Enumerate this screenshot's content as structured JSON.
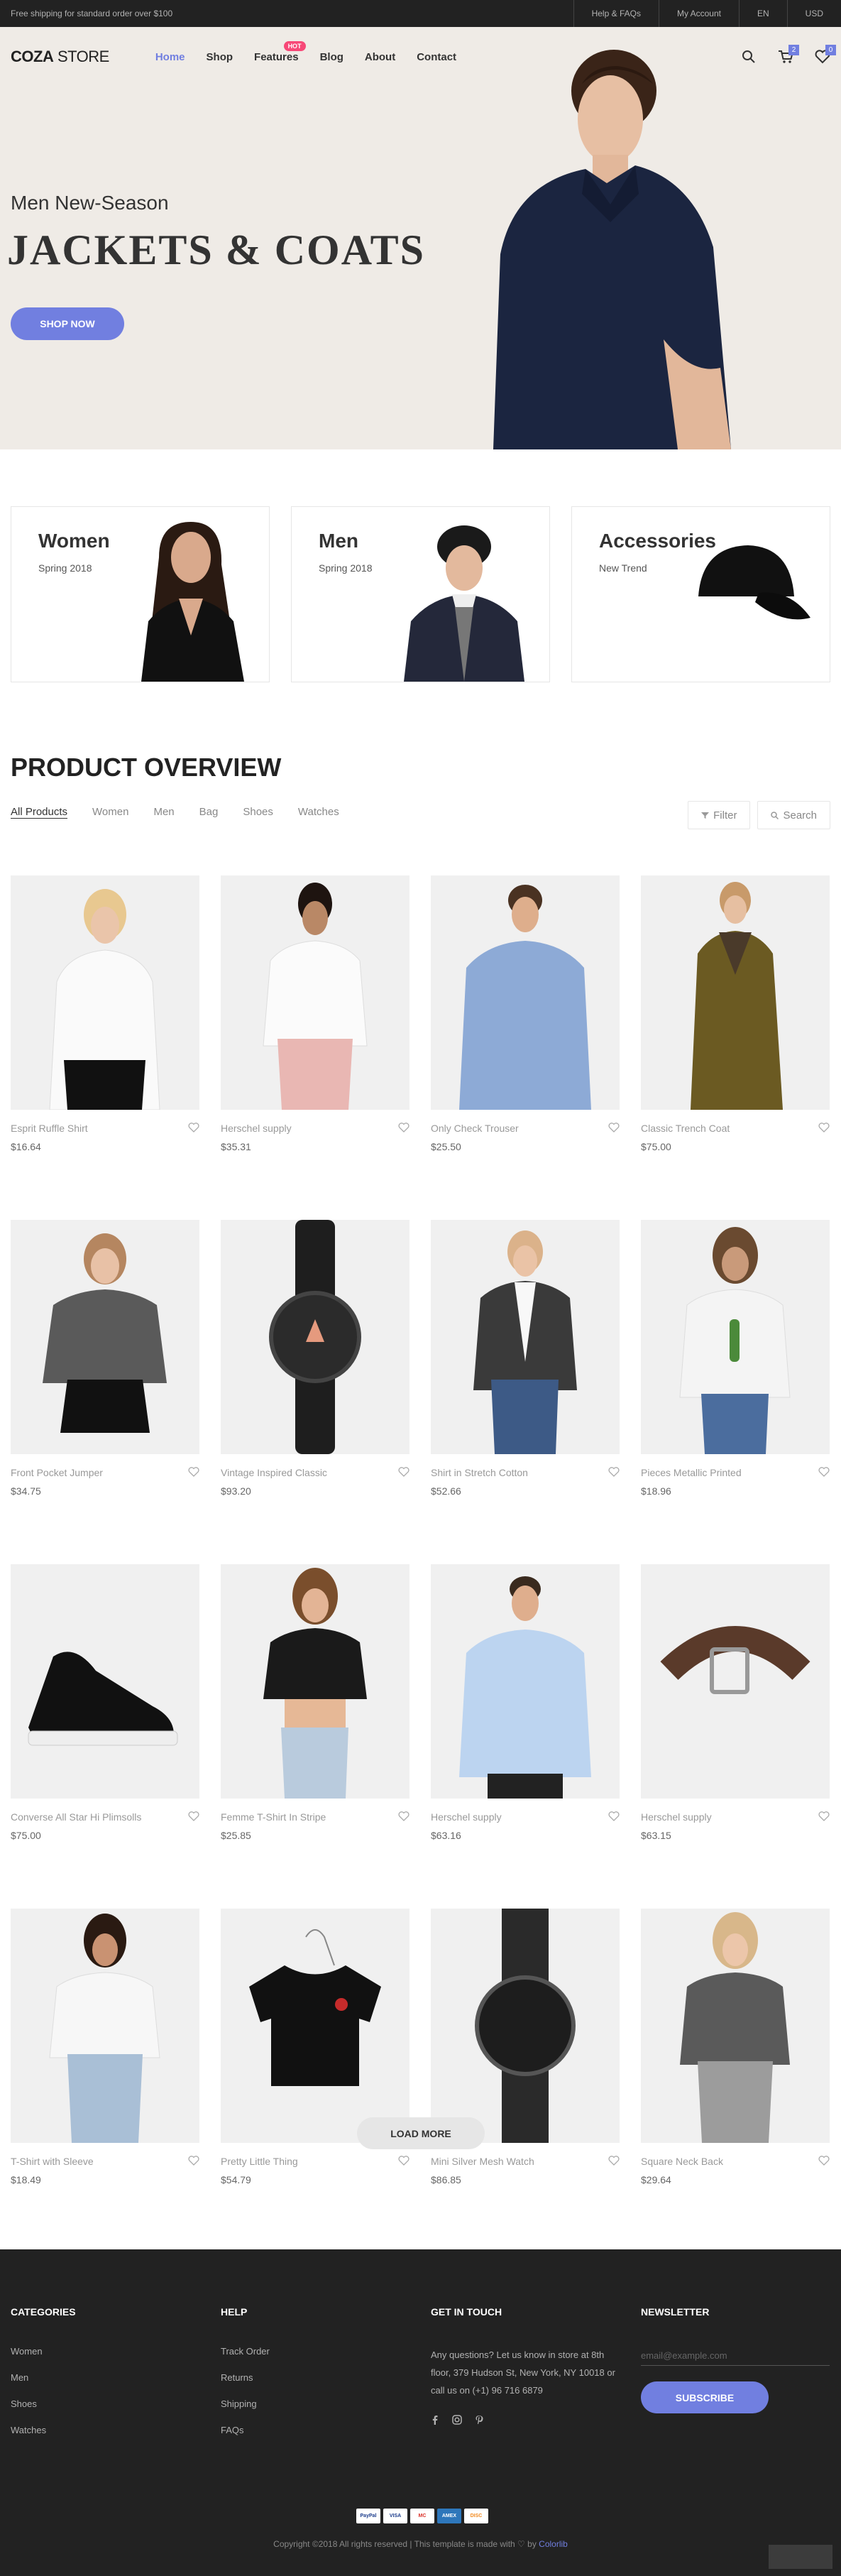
{
  "topbar": {
    "shipping": "Free shipping for standard order over $100",
    "links": [
      "Help & FAQs",
      "My Account",
      "EN",
      "USD"
    ]
  },
  "nav": {
    "logo_bold": "COZA",
    "logo_light": " STORE",
    "items": [
      "Home",
      "Shop",
      "Features",
      "Blog",
      "About",
      "Contact"
    ],
    "hot_badge": "HOT",
    "cart_count": "2",
    "wishlist_count": "0"
  },
  "hero": {
    "subtitle": "Men New-Season",
    "title": "JACKETS & COATS",
    "button": "SHOP NOW"
  },
  "banners": [
    {
      "title": "Women",
      "sub": "Spring 2018"
    },
    {
      "title": "Men",
      "sub": "Spring 2018"
    },
    {
      "title": "Accessories",
      "sub": "New Trend"
    }
  ],
  "overview": {
    "title": "PRODUCT OVERVIEW",
    "filters": [
      "All Products",
      "Women",
      "Men",
      "Bag",
      "Shoes",
      "Watches"
    ],
    "filter_btn": "Filter",
    "search_btn": "Search"
  },
  "products": [
    {
      "name": "Esprit Ruffle Shirt",
      "price": "$16.64",
      "kind": "woman-white"
    },
    {
      "name": "Herschel supply",
      "price": "$35.31",
      "kind": "woman-pink"
    },
    {
      "name": "Only Check Trouser",
      "price": "$25.50",
      "kind": "man-blue"
    },
    {
      "name": "Classic Trench Coat",
      "price": "$75.00",
      "kind": "woman-coat"
    },
    {
      "name": "Front Pocket Jumper",
      "price": "$34.75",
      "kind": "woman-grey"
    },
    {
      "name": "Vintage Inspired Classic",
      "price": "$93.20",
      "kind": "watch-black"
    },
    {
      "name": "Shirt in Stretch Cotton",
      "price": "$52.66",
      "kind": "woman-blazer"
    },
    {
      "name": "Pieces Metallic Printed",
      "price": "$18.96",
      "kind": "woman-cactus"
    },
    {
      "name": "Converse All Star Hi Plimsolls",
      "price": "$75.00",
      "kind": "shoe"
    },
    {
      "name": "Femme T-Shirt In Stripe",
      "price": "$25.85",
      "kind": "woman-crop"
    },
    {
      "name": "Herschel supply",
      "price": "$63.16",
      "kind": "man-shirt"
    },
    {
      "name": "Herschel supply",
      "price": "$63.15",
      "kind": "belt"
    },
    {
      "name": "T-Shirt with Sleeve",
      "price": "$18.49",
      "kind": "woman-jeans"
    },
    {
      "name": "Pretty Little Thing",
      "price": "$54.79",
      "kind": "tee-rose"
    },
    {
      "name": "Mini Silver Mesh Watch",
      "price": "$86.85",
      "kind": "watch-mesh"
    },
    {
      "name": "Square Neck Back",
      "price": "$29.64",
      "kind": "woman-jogger"
    }
  ],
  "load_more": "LOAD MORE",
  "footer": {
    "categories": {
      "title": "CATEGORIES",
      "items": [
        "Women",
        "Men",
        "Shoes",
        "Watches"
      ]
    },
    "help": {
      "title": "HELP",
      "items": [
        "Track Order",
        "Returns",
        "Shipping",
        "FAQs"
      ]
    },
    "touch": {
      "title": "GET IN TOUCH",
      "text": "Any questions? Let us know in store at 8th floor, 379 Hudson St, New York, NY 10018 or call us on (+1) 96 716 6879"
    },
    "newsletter": {
      "title": "NEWSLETTER",
      "placeholder": "email@example.com",
      "button": "SUBSCRIBE"
    },
    "payments": [
      "PayPal",
      "VISA",
      "MC",
      "AMEX",
      "DISC"
    ],
    "copyright": "Copyright ©2018 All rights reserved | This template is made with ♡ by ",
    "credit": "Colorlib"
  }
}
